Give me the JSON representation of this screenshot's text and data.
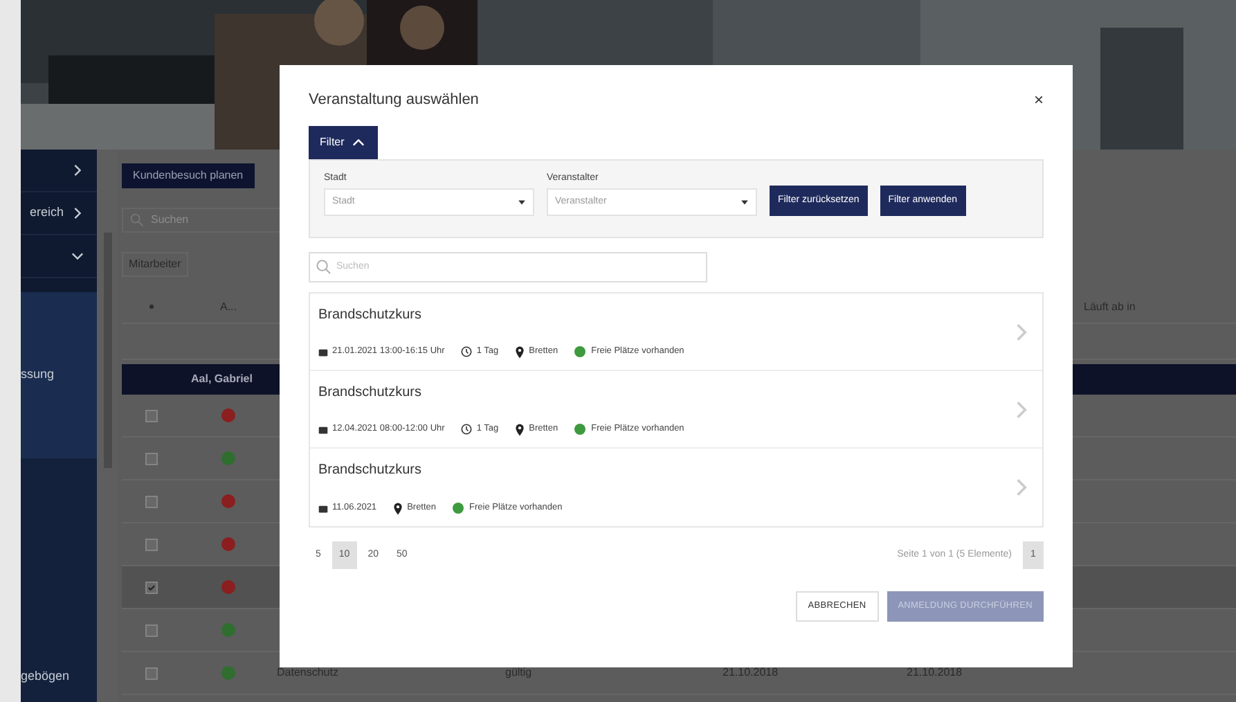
{
  "sidebar": {
    "items": [
      {
        "expanded": false
      },
      {
        "label": "ereich",
        "expanded": false
      },
      {
        "expanded": true
      }
    ],
    "sub_items": [
      {
        "label": "ssung",
        "selected": true
      },
      {
        "label": "gebögen",
        "selected": false
      }
    ]
  },
  "content": {
    "plan_button": "Kundenbesuch planen",
    "search": {
      "placeholder": "Suchen"
    },
    "sort_chip": "Mitarbeiter",
    "table": {
      "columns": [
        {
          "label": "A..."
        },
        {
          "label": "Läuft ab in"
        }
      ],
      "group": "Aal, Gabriel",
      "rows": [
        {
          "checked": false,
          "color": "#8b1e1e"
        },
        {
          "checked": false,
          "color": "#2f6e2f"
        },
        {
          "checked": false,
          "color": "#8b1e1e"
        },
        {
          "checked": false,
          "color": "#8b1e1e"
        },
        {
          "checked": true,
          "color": "#8b1e1e"
        },
        {
          "checked": false,
          "color": "#2f6e2f"
        },
        {
          "checked": false,
          "color": "#2f6e2f",
          "cells": [
            "Datenschutz",
            "gültig",
            "21.10.2018",
            "21.10.2018"
          ]
        }
      ]
    }
  },
  "dialog": {
    "title": "Veranstaltung auswählen",
    "close": "×",
    "filter": {
      "label": "Filter",
      "expanded": true,
      "fields": [
        {
          "label": "Stadt",
          "placeholder": "Stadt"
        },
        {
          "label": "Veranstalter",
          "placeholder": "Veranstalter"
        }
      ],
      "buttons": [
        "Filter zurücksetzen",
        "Filter anwenden"
      ]
    },
    "search": {
      "placeholder": "Suchen"
    },
    "events": [
      {
        "title": "Brandschutzkurs",
        "date": "21.01.2021 13:00-16:15 Uhr",
        "duration": "1 Tag",
        "location": "Bretten",
        "status": "Freie Plätze vorhanden",
        "color": "#3e9a3e"
      },
      {
        "title": "Brandschutzkurs",
        "date": "12.04.2021 08:00-12:00 Uhr",
        "duration": "1 Tag",
        "location": "Bretten",
        "status": "Freie Plätze vorhanden",
        "color": "#3e9a3e"
      },
      {
        "title": "Brandschutzkurs",
        "date": "11.06.2021",
        "location": "Bretten",
        "status": "Freie Plätze vorhanden",
        "color": "#3e9a3e"
      }
    ],
    "page_sizes": [
      {
        "label": "5",
        "selected": false
      },
      {
        "label": "10",
        "selected": true
      },
      {
        "label": "20",
        "selected": false
      },
      {
        "label": "50",
        "selected": false
      }
    ],
    "page_info": "Seite 1 von 1 (5 Elemente)",
    "pages": [
      {
        "label": "1",
        "selected": true
      }
    ],
    "actions": [
      {
        "label": "ABBRECHEN",
        "kind": "secondary",
        "disabled": false
      },
      {
        "label": "ANMELDUNG DURCHFÜHREN",
        "kind": "primary",
        "disabled": true
      }
    ]
  }
}
